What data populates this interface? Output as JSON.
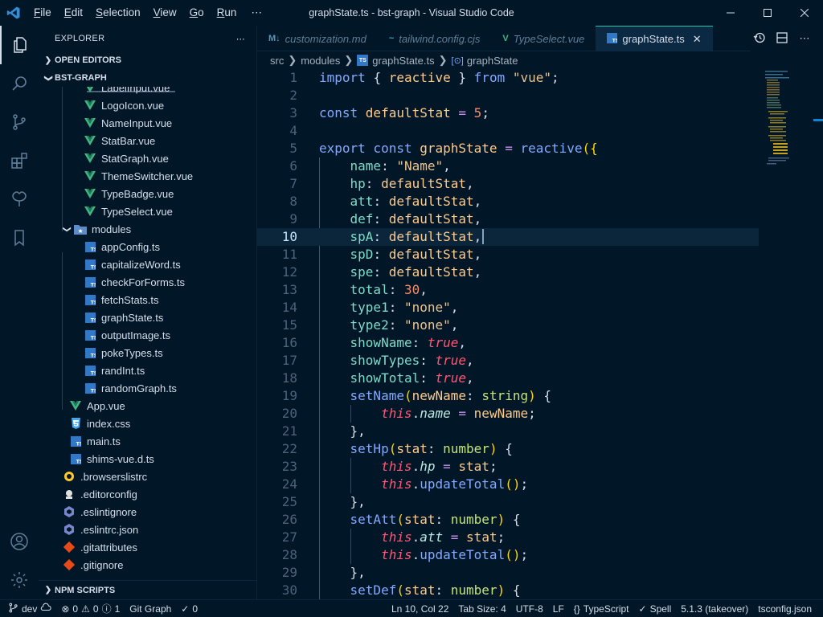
{
  "window": {
    "title": "graphState.ts - bst-graph - Visual Studio Code",
    "menu": [
      {
        "label": "File",
        "key": "F",
        "rest": "ile"
      },
      {
        "label": "Edit",
        "key": "E",
        "rest": "dit"
      },
      {
        "label": "Selection",
        "key": "S",
        "rest": "election"
      },
      {
        "label": "View",
        "key": "V",
        "rest": "iew"
      },
      {
        "label": "Go",
        "key": "G",
        "rest": "o"
      },
      {
        "label": "Run",
        "key": "R",
        "rest": "un"
      }
    ],
    "menu_more": "⋯"
  },
  "activity": [
    "explorer-icon",
    "search-icon",
    "source-control-icon",
    "extensions-icon",
    "remote-icon",
    "bookmarks-icon",
    "account-icon",
    "settings-gear-icon"
  ],
  "sidebar": {
    "title": "EXPLORER",
    "more": "⋯",
    "open_editors": "OPEN EDITORS",
    "project": "BST-GRAPH",
    "files": [
      {
        "name": "LabelInput.vue",
        "type": "vue",
        "indent": 3
      },
      {
        "name": "LogoIcon.vue",
        "type": "vue",
        "indent": 3
      },
      {
        "name": "NameInput.vue",
        "type": "vue",
        "indent": 3
      },
      {
        "name": "StatBar.vue",
        "type": "vue",
        "indent": 3
      },
      {
        "name": "StatGraph.vue",
        "type": "vue",
        "indent": 3
      },
      {
        "name": "ThemeSwitcher.vue",
        "type": "vue",
        "indent": 3
      },
      {
        "name": "TypeBadge.vue",
        "type": "vue",
        "indent": 3
      },
      {
        "name": "TypeSelect.vue",
        "type": "vue",
        "indent": 3
      },
      {
        "name": "modules",
        "type": "folder",
        "indent": 2
      },
      {
        "name": "appConfig.ts",
        "type": "ts",
        "indent": 3
      },
      {
        "name": "capitalizeWord.ts",
        "type": "ts",
        "indent": 3
      },
      {
        "name": "checkForForms.ts",
        "type": "ts",
        "indent": 3
      },
      {
        "name": "fetchStats.ts",
        "type": "ts",
        "indent": 3
      },
      {
        "name": "graphState.ts",
        "type": "ts",
        "indent": 3
      },
      {
        "name": "outputImage.ts",
        "type": "ts",
        "indent": 3
      },
      {
        "name": "pokeTypes.ts",
        "type": "ts",
        "indent": 3
      },
      {
        "name": "randInt.ts",
        "type": "ts",
        "indent": 3
      },
      {
        "name": "randomGraph.ts",
        "type": "ts",
        "indent": 3
      },
      {
        "name": "App.vue",
        "type": "vue",
        "indent": 2
      },
      {
        "name": "index.css",
        "type": "css",
        "indent": 2
      },
      {
        "name": "main.ts",
        "type": "ts",
        "indent": 2
      },
      {
        "name": "shims-vue.d.ts",
        "type": "ts",
        "indent": 2
      },
      {
        "name": ".browserslistrc",
        "type": "browserslist",
        "indent": 1
      },
      {
        "name": ".editorconfig",
        "type": "editorconfig",
        "indent": 1
      },
      {
        "name": ".eslintignore",
        "type": "eslint",
        "indent": 1
      },
      {
        "name": ".eslintrc.json",
        "type": "eslint",
        "indent": 1
      },
      {
        "name": ".gitattributes",
        "type": "git",
        "indent": 1
      },
      {
        "name": ".gitignore",
        "type": "git",
        "indent": 1
      }
    ],
    "npm_scripts": "NPM SCRIPTS"
  },
  "tabs": [
    {
      "label": "customization.md",
      "icon": "M↓",
      "icon_color": "#519aba",
      "active": false
    },
    {
      "label": "tailwind.config.cjs",
      "icon": "~",
      "icon_color": "#44a8b3",
      "active": false
    },
    {
      "label": "TypeSelect.vue",
      "icon": "V",
      "icon_color": "#41b883",
      "active": false
    },
    {
      "label": "graphState.ts",
      "icon": "TS",
      "icon_color": "#3178c6",
      "active": true
    }
  ],
  "tab_close": "✕",
  "breadcrumb": [
    "src",
    "modules",
    "graphState.ts",
    "graphState"
  ],
  "editor": {
    "current_line": 10,
    "lines": [
      [
        [
          "kwb",
          "import "
        ],
        [
          "punc",
          "{ "
        ],
        [
          "var",
          "reactive"
        ],
        [
          "punc",
          " } "
        ],
        [
          "kwb",
          "from "
        ],
        [
          "str",
          "\"vue\""
        ],
        [
          "punc",
          ";"
        ]
      ],
      [],
      [
        [
          "kwb",
          "const "
        ],
        [
          "var",
          "defaultStat"
        ],
        [
          "op",
          " = "
        ],
        [
          "num",
          "5"
        ],
        [
          "punc",
          ";"
        ]
      ],
      [],
      [
        [
          "kwb",
          "export const "
        ],
        [
          "var",
          "graphState"
        ],
        [
          "op",
          " = "
        ],
        [
          "fn",
          "reactive"
        ],
        [
          "par",
          "({"
        ]
      ],
      [
        [
          "plain",
          "    "
        ],
        [
          "prop",
          "name"
        ],
        [
          "punc",
          ": "
        ],
        [
          "str",
          "\"Name\""
        ],
        [
          "punc",
          ","
        ]
      ],
      [
        [
          "plain",
          "    "
        ],
        [
          "prop",
          "hp"
        ],
        [
          "punc",
          ": "
        ],
        [
          "var",
          "defaultStat"
        ],
        [
          "punc",
          ","
        ]
      ],
      [
        [
          "plain",
          "    "
        ],
        [
          "prop",
          "att"
        ],
        [
          "punc",
          ": "
        ],
        [
          "var",
          "defaultStat"
        ],
        [
          "punc",
          ","
        ]
      ],
      [
        [
          "plain",
          "    "
        ],
        [
          "prop",
          "def"
        ],
        [
          "punc",
          ": "
        ],
        [
          "var",
          "defaultStat"
        ],
        [
          "punc",
          ","
        ]
      ],
      [
        [
          "plain",
          "    "
        ],
        [
          "prop",
          "spA"
        ],
        [
          "punc",
          ": "
        ],
        [
          "var",
          "defaultStat"
        ],
        [
          "punc",
          ","
        ]
      ],
      [
        [
          "plain",
          "    "
        ],
        [
          "prop",
          "spD"
        ],
        [
          "punc",
          ": "
        ],
        [
          "var",
          "defaultStat"
        ],
        [
          "punc",
          ","
        ]
      ],
      [
        [
          "plain",
          "    "
        ],
        [
          "prop",
          "spe"
        ],
        [
          "punc",
          ": "
        ],
        [
          "var",
          "defaultStat"
        ],
        [
          "punc",
          ","
        ]
      ],
      [
        [
          "plain",
          "    "
        ],
        [
          "prop",
          "total"
        ],
        [
          "punc",
          ": "
        ],
        [
          "num",
          "30"
        ],
        [
          "punc",
          ","
        ]
      ],
      [
        [
          "plain",
          "    "
        ],
        [
          "prop",
          "type1"
        ],
        [
          "punc",
          ": "
        ],
        [
          "str",
          "\"none\""
        ],
        [
          "punc",
          ","
        ]
      ],
      [
        [
          "plain",
          "    "
        ],
        [
          "prop",
          "type2"
        ],
        [
          "punc",
          ": "
        ],
        [
          "str",
          "\"none\""
        ],
        [
          "punc",
          ","
        ]
      ],
      [
        [
          "plain",
          "    "
        ],
        [
          "prop",
          "showName"
        ],
        [
          "punc",
          ": "
        ],
        [
          "bool",
          "true"
        ],
        [
          "punc",
          ","
        ]
      ],
      [
        [
          "plain",
          "    "
        ],
        [
          "prop",
          "showTypes"
        ],
        [
          "punc",
          ": "
        ],
        [
          "bool",
          "true"
        ],
        [
          "punc",
          ","
        ]
      ],
      [
        [
          "plain",
          "    "
        ],
        [
          "prop",
          "showTotal"
        ],
        [
          "punc",
          ": "
        ],
        [
          "bool",
          "true"
        ],
        [
          "punc",
          ","
        ]
      ],
      [
        [
          "plain",
          "    "
        ],
        [
          "fn",
          "setName"
        ],
        [
          "par",
          "("
        ],
        [
          "var",
          "newName"
        ],
        [
          "punc",
          ": "
        ],
        [
          "ty",
          "string"
        ],
        [
          "par",
          ")"
        ],
        [
          "punc",
          " {"
        ]
      ],
      [
        [
          "plain",
          "        "
        ],
        [
          "this",
          "this"
        ],
        [
          "punc",
          "."
        ],
        [
          "italprop",
          "name"
        ],
        [
          "op",
          " = "
        ],
        [
          "var",
          "newName"
        ],
        [
          "punc",
          ";"
        ]
      ],
      [
        [
          "plain",
          "    "
        ],
        [
          "punc",
          "},"
        ]
      ],
      [
        [
          "plain",
          "    "
        ],
        [
          "fn",
          "setHp"
        ],
        [
          "par",
          "("
        ],
        [
          "var",
          "stat"
        ],
        [
          "punc",
          ": "
        ],
        [
          "ty",
          "number"
        ],
        [
          "par",
          ")"
        ],
        [
          "punc",
          " {"
        ]
      ],
      [
        [
          "plain",
          "        "
        ],
        [
          "this",
          "this"
        ],
        [
          "punc",
          "."
        ],
        [
          "italprop",
          "hp"
        ],
        [
          "op",
          " = "
        ],
        [
          "var",
          "stat"
        ],
        [
          "punc",
          ";"
        ]
      ],
      [
        [
          "plain",
          "        "
        ],
        [
          "this",
          "this"
        ],
        [
          "punc",
          "."
        ],
        [
          "fn",
          "updateTotal"
        ],
        [
          "par",
          "()"
        ],
        [
          "punc",
          ";"
        ]
      ],
      [
        [
          "plain",
          "    "
        ],
        [
          "punc",
          "},"
        ]
      ],
      [
        [
          "plain",
          "    "
        ],
        [
          "fn",
          "setAtt"
        ],
        [
          "par",
          "("
        ],
        [
          "var",
          "stat"
        ],
        [
          "punc",
          ": "
        ],
        [
          "ty",
          "number"
        ],
        [
          "par",
          ")"
        ],
        [
          "punc",
          " {"
        ]
      ],
      [
        [
          "plain",
          "        "
        ],
        [
          "this",
          "this"
        ],
        [
          "punc",
          "."
        ],
        [
          "italprop",
          "att"
        ],
        [
          "op",
          " = "
        ],
        [
          "var",
          "stat"
        ],
        [
          "punc",
          ";"
        ]
      ],
      [
        [
          "plain",
          "        "
        ],
        [
          "this",
          "this"
        ],
        [
          "punc",
          "."
        ],
        [
          "fn",
          "updateTotal"
        ],
        [
          "par",
          "()"
        ],
        [
          "punc",
          ";"
        ]
      ],
      [
        [
          "plain",
          "    "
        ],
        [
          "punc",
          "},"
        ]
      ],
      [
        [
          "plain",
          "    "
        ],
        [
          "fn",
          "setDef"
        ],
        [
          "par",
          "("
        ],
        [
          "var",
          "stat"
        ],
        [
          "punc",
          ": "
        ],
        [
          "ty",
          "number"
        ],
        [
          "par",
          ")"
        ],
        [
          "punc",
          " {"
        ]
      ]
    ]
  },
  "status": {
    "branch": "dev",
    "errors": "0",
    "warnings": "0",
    "info": "1",
    "git_graph": "Git Graph",
    "checks": "0",
    "position": "Ln 10, Col 22",
    "tab_size": "Tab Size: 4",
    "encoding": "UTF-8",
    "eol": "LF",
    "language": "TypeScript",
    "spell": "Spell",
    "ts_version": "5.1.3 (takeover)",
    "tsconfig": "tsconfig.json"
  }
}
